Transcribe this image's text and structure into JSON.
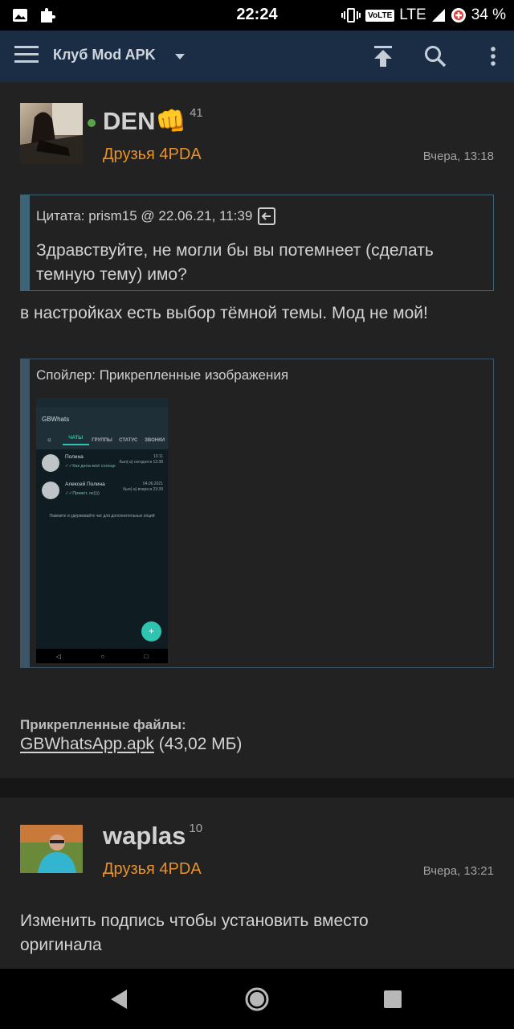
{
  "status_bar": {
    "time": "22:24",
    "volte": "VoLTE",
    "network": "LTE",
    "battery": "34 %"
  },
  "app_bar": {
    "title": "Клуб Mod APK",
    "icons": [
      "menu-icon",
      "scroll-top-icon",
      "search-icon",
      "more-icon"
    ]
  },
  "posts": [
    {
      "author": "DEN👊",
      "reputation": "41",
      "group": "Друзья 4PDA",
      "date": "Вчера, 13:18",
      "quote": {
        "header": "Цитата: prism15 @ 22.06.21, 11:39",
        "text": "Здравствуйте, не могли бы вы потемнеет (сделать темную тему) имо?"
      },
      "text": "в настройках есть выбор тёмной темы. Мод не мой!",
      "spoiler": {
        "header": "Спойлер: Прикрепленные изображения",
        "screenshot": {
          "app_title": "GBWhats",
          "tabs": [
            "",
            "ЧАТЫ",
            "ГРУППЫ",
            "СТАТУС",
            "ЗВОНКИ"
          ],
          "chats": [
            {
              "name": "Полина",
              "time": "13:11",
              "status": "был(-а) сегодня в 12:38",
              "message": "✓✓Как дела моё солнце"
            },
            {
              "name": "Алексей Полина",
              "time": "04.06.2021",
              "status": "был(-а) вчера в 23:39",
              "message": "✓✓Привет, ок))))"
            }
          ],
          "hint": "Нажмите и удерживайте чат для дополнительных опций",
          "fab": "+"
        }
      },
      "attachments_label": "Прикрепленные файлы:",
      "attachment_name": "GBWhatsApp.apk",
      "attachment_size": "(43,02 МБ)"
    },
    {
      "author": "waplas",
      "reputation": "10",
      "group": "Друзья 4PDA",
      "date": "Вчера, 13:21",
      "text": "Изменить подпись чтобы установить вместо оригинала"
    }
  ],
  "colors": {
    "app_bar": "#1b2d45",
    "background": "#222222",
    "group": "#e8922c",
    "quote_border": "#3d6476"
  }
}
